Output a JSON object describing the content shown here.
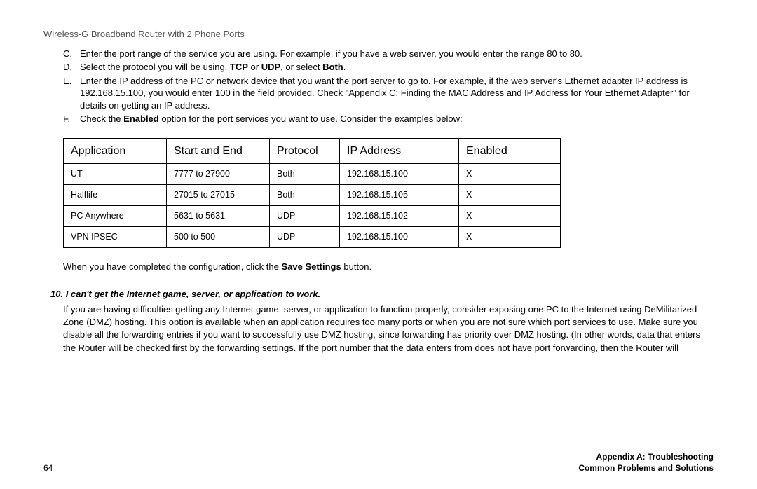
{
  "header": {
    "title": "Wireless-G Broadband Router with 2 Phone Ports"
  },
  "steps": {
    "c": {
      "letter": "C.",
      "text": "Enter the port range of the service you are using. For example, if you have a web server, you would enter the range 80 to 80."
    },
    "d": {
      "letter": "D.",
      "prefix": "Select the protocol you will be using, ",
      "b1": "TCP",
      "mid1": " or ",
      "b2": "UDP",
      "mid2": ", or select ",
      "b3": "Both",
      "suffix": "."
    },
    "e": {
      "letter": "E.",
      "text": "Enter the IP address of the PC or network device that you want the port server to go to. For example, if the web server's Ethernet adapter IP address is 192.168.15.100, you would enter 100 in the field provided. Check \"Appendix C: Finding the MAC Address and IP Address for Your Ethernet Adapter\" for details on getting an IP address."
    },
    "f": {
      "letter": "F.",
      "prefix": "Check the ",
      "b1": "Enabled",
      "suffix": " option for the port services you want to use. Consider the examples below:"
    }
  },
  "table": {
    "headers": {
      "app": "Application",
      "se": "Start and End",
      "proto": "Protocol",
      "ip": "IP Address",
      "en": "Enabled"
    },
    "rows": [
      {
        "app": "UT",
        "se": "7777 to 27900",
        "proto": "Both",
        "ip": "192.168.15.100",
        "en": "X"
      },
      {
        "app": "Halflife",
        "se": "27015 to 27015",
        "proto": "Both",
        "ip": "192.168.15.105",
        "en": "X"
      },
      {
        "app": "PC Anywhere",
        "se": "5631 to 5631",
        "proto": "UDP",
        "ip": "192.168.15.102",
        "en": "X"
      },
      {
        "app": "VPN IPSEC",
        "se": "500 to 500",
        "proto": "UDP",
        "ip": "192.168.15.100",
        "en": "X"
      }
    ]
  },
  "post_table": {
    "prefix": "When you have completed the configuration, click the ",
    "b": "Save Settings",
    "suffix": " button."
  },
  "qa": {
    "num": "10.",
    "title": "I can't get the Internet game, server, or application to work.",
    "body": "If you are having difficulties getting any Internet game, server, or application to function properly, consider exposing one PC to the Internet using DeMilitarized Zone (DMZ) hosting. This option is available when an application requires too many ports or when you are not sure which port services to use. Make sure you disable all the forwarding entries if you want to successfully use DMZ hosting, since forwarding has priority over DMZ hosting. (In other words, data that enters the Router will be checked first by the forwarding settings. If the port number that the data enters from does not have port forwarding, then the Router will"
  },
  "footer": {
    "page": "64",
    "right1": "Appendix A: Troubleshooting",
    "right2": "Common Problems and Solutions"
  }
}
